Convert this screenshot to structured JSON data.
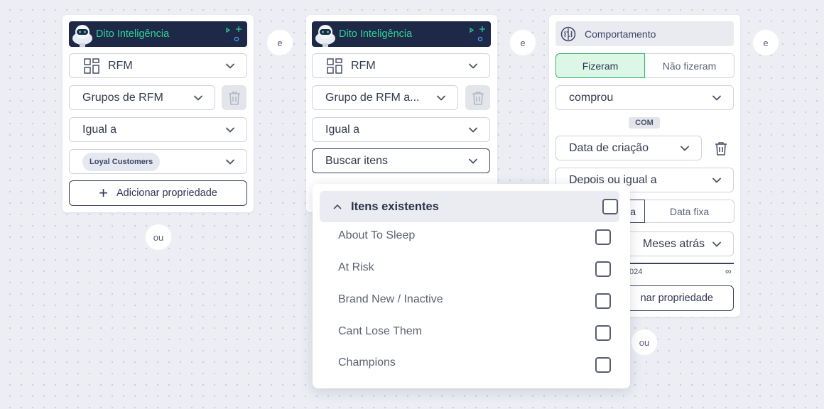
{
  "colors": {
    "brand_green": "#2fd39a",
    "banner_bg": "#1d2947",
    "selected_bg": "#dcf7e6",
    "selected_border": "#33b36a"
  },
  "card1": {
    "banner_title": "Dito Inteligência",
    "property": "RFM",
    "group_select": "Grupos de RFM",
    "operator": "Igual a",
    "value_chip": "Loyal Customers",
    "add_button": "Adicionar propriedade"
  },
  "card2": {
    "banner_title": "Dito Inteligência",
    "property": "RFM",
    "group_select": "Grupo de RFM a...",
    "operator": "Igual a",
    "search_select": "Buscar itens"
  },
  "card3": {
    "title": "Comportamento",
    "toggle": {
      "selected": "Fizeram",
      "other": "Não fizeram"
    },
    "event_select": "comprou",
    "com_badge": "COM",
    "date_property": "Data de criação",
    "date_operator": "Depois ou igual a",
    "date_mode": {
      "left_partial": "a",
      "right": "Data fixa"
    },
    "relative_unit": "Meses atrás",
    "range_start_partial": "024",
    "range_end": "∞",
    "add_button_partial": "nar propriedade"
  },
  "connectors": {
    "and_1": "e",
    "and_2": "e",
    "and_3": "e",
    "or_1": "ou",
    "or_2": "ou"
  },
  "dropdown": {
    "header": "Itens existentes",
    "items": [
      {
        "label": "About To Sleep",
        "checked": false
      },
      {
        "label": "At Risk",
        "checked": false
      },
      {
        "label": "Brand New / Inactive",
        "checked": false
      },
      {
        "label": "Cant Lose Them",
        "checked": false
      },
      {
        "label": "Champions",
        "checked": false
      }
    ]
  }
}
